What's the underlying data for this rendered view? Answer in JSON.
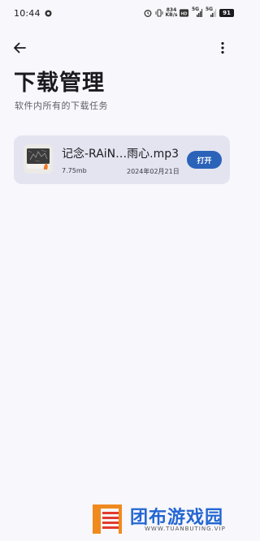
{
  "status_bar": {
    "time": "10:44",
    "net_speed": "834 KB/s",
    "sig1": "5G",
    "sig2": "5G",
    "battery": "91"
  },
  "header": {
    "back_icon": "arrow-left-icon",
    "more_icon": "more-vertical-icon",
    "title": "下载管理",
    "subtitle": "软件内所有的下载任务"
  },
  "downloads": [
    {
      "name": "记念-RAiN…雨心.mp3",
      "size": "7.75mb",
      "date": "2024年02月21日",
      "action": "打开",
      "thumb_icon": "music-file-thumbnail-icon"
    }
  ],
  "watermark": {
    "name": "团布游戏园",
    "url": "WWW.TUANBUTING.VIP"
  },
  "colors": {
    "background": "#f7f7fc",
    "card": "#e3e4f0",
    "accent": "#2b63b8",
    "brand": "#2366d1"
  }
}
